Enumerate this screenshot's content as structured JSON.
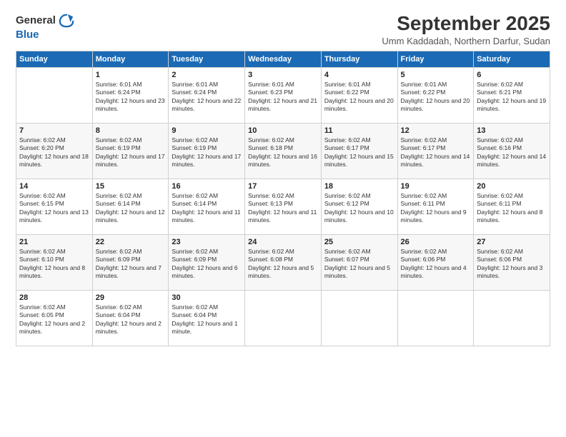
{
  "logo": {
    "general": "General",
    "blue": "Blue"
  },
  "header": {
    "month_year": "September 2025",
    "location": "Umm Kaddadah, Northern Darfur, Sudan"
  },
  "days_of_week": [
    "Sunday",
    "Monday",
    "Tuesday",
    "Wednesday",
    "Thursday",
    "Friday",
    "Saturday"
  ],
  "weeks": [
    [
      {
        "day": "",
        "sunrise": "",
        "sunset": "",
        "daylight": ""
      },
      {
        "day": "1",
        "sunrise": "Sunrise: 6:01 AM",
        "sunset": "Sunset: 6:24 PM",
        "daylight": "Daylight: 12 hours and 23 minutes."
      },
      {
        "day": "2",
        "sunrise": "Sunrise: 6:01 AM",
        "sunset": "Sunset: 6:24 PM",
        "daylight": "Daylight: 12 hours and 22 minutes."
      },
      {
        "day": "3",
        "sunrise": "Sunrise: 6:01 AM",
        "sunset": "Sunset: 6:23 PM",
        "daylight": "Daylight: 12 hours and 21 minutes."
      },
      {
        "day": "4",
        "sunrise": "Sunrise: 6:01 AM",
        "sunset": "Sunset: 6:22 PM",
        "daylight": "Daylight: 12 hours and 20 minutes."
      },
      {
        "day": "5",
        "sunrise": "Sunrise: 6:01 AM",
        "sunset": "Sunset: 6:22 PM",
        "daylight": "Daylight: 12 hours and 20 minutes."
      },
      {
        "day": "6",
        "sunrise": "Sunrise: 6:02 AM",
        "sunset": "Sunset: 6:21 PM",
        "daylight": "Daylight: 12 hours and 19 minutes."
      }
    ],
    [
      {
        "day": "7",
        "sunrise": "Sunrise: 6:02 AM",
        "sunset": "Sunset: 6:20 PM",
        "daylight": "Daylight: 12 hours and 18 minutes."
      },
      {
        "day": "8",
        "sunrise": "Sunrise: 6:02 AM",
        "sunset": "Sunset: 6:19 PM",
        "daylight": "Daylight: 12 hours and 17 minutes."
      },
      {
        "day": "9",
        "sunrise": "Sunrise: 6:02 AM",
        "sunset": "Sunset: 6:19 PM",
        "daylight": "Daylight: 12 hours and 17 minutes."
      },
      {
        "day": "10",
        "sunrise": "Sunrise: 6:02 AM",
        "sunset": "Sunset: 6:18 PM",
        "daylight": "Daylight: 12 hours and 16 minutes."
      },
      {
        "day": "11",
        "sunrise": "Sunrise: 6:02 AM",
        "sunset": "Sunset: 6:17 PM",
        "daylight": "Daylight: 12 hours and 15 minutes."
      },
      {
        "day": "12",
        "sunrise": "Sunrise: 6:02 AM",
        "sunset": "Sunset: 6:17 PM",
        "daylight": "Daylight: 12 hours and 14 minutes."
      },
      {
        "day": "13",
        "sunrise": "Sunrise: 6:02 AM",
        "sunset": "Sunset: 6:16 PM",
        "daylight": "Daylight: 12 hours and 14 minutes."
      }
    ],
    [
      {
        "day": "14",
        "sunrise": "Sunrise: 6:02 AM",
        "sunset": "Sunset: 6:15 PM",
        "daylight": "Daylight: 12 hours and 13 minutes."
      },
      {
        "day": "15",
        "sunrise": "Sunrise: 6:02 AM",
        "sunset": "Sunset: 6:14 PM",
        "daylight": "Daylight: 12 hours and 12 minutes."
      },
      {
        "day": "16",
        "sunrise": "Sunrise: 6:02 AM",
        "sunset": "Sunset: 6:14 PM",
        "daylight": "Daylight: 12 hours and 11 minutes."
      },
      {
        "day": "17",
        "sunrise": "Sunrise: 6:02 AM",
        "sunset": "Sunset: 6:13 PM",
        "daylight": "Daylight: 12 hours and 11 minutes."
      },
      {
        "day": "18",
        "sunrise": "Sunrise: 6:02 AM",
        "sunset": "Sunset: 6:12 PM",
        "daylight": "Daylight: 12 hours and 10 minutes."
      },
      {
        "day": "19",
        "sunrise": "Sunrise: 6:02 AM",
        "sunset": "Sunset: 6:11 PM",
        "daylight": "Daylight: 12 hours and 9 minutes."
      },
      {
        "day": "20",
        "sunrise": "Sunrise: 6:02 AM",
        "sunset": "Sunset: 6:11 PM",
        "daylight": "Daylight: 12 hours and 8 minutes."
      }
    ],
    [
      {
        "day": "21",
        "sunrise": "Sunrise: 6:02 AM",
        "sunset": "Sunset: 6:10 PM",
        "daylight": "Daylight: 12 hours and 8 minutes."
      },
      {
        "day": "22",
        "sunrise": "Sunrise: 6:02 AM",
        "sunset": "Sunset: 6:09 PM",
        "daylight": "Daylight: 12 hours and 7 minutes."
      },
      {
        "day": "23",
        "sunrise": "Sunrise: 6:02 AM",
        "sunset": "Sunset: 6:09 PM",
        "daylight": "Daylight: 12 hours and 6 minutes."
      },
      {
        "day": "24",
        "sunrise": "Sunrise: 6:02 AM",
        "sunset": "Sunset: 6:08 PM",
        "daylight": "Daylight: 12 hours and 5 minutes."
      },
      {
        "day": "25",
        "sunrise": "Sunrise: 6:02 AM",
        "sunset": "Sunset: 6:07 PM",
        "daylight": "Daylight: 12 hours and 5 minutes."
      },
      {
        "day": "26",
        "sunrise": "Sunrise: 6:02 AM",
        "sunset": "Sunset: 6:06 PM",
        "daylight": "Daylight: 12 hours and 4 minutes."
      },
      {
        "day": "27",
        "sunrise": "Sunrise: 6:02 AM",
        "sunset": "Sunset: 6:06 PM",
        "daylight": "Daylight: 12 hours and 3 minutes."
      }
    ],
    [
      {
        "day": "28",
        "sunrise": "Sunrise: 6:02 AM",
        "sunset": "Sunset: 6:05 PM",
        "daylight": "Daylight: 12 hours and 2 minutes."
      },
      {
        "day": "29",
        "sunrise": "Sunrise: 6:02 AM",
        "sunset": "Sunset: 6:04 PM",
        "daylight": "Daylight: 12 hours and 2 minutes."
      },
      {
        "day": "30",
        "sunrise": "Sunrise: 6:02 AM",
        "sunset": "Sunset: 6:04 PM",
        "daylight": "Daylight: 12 hours and 1 minute."
      },
      {
        "day": "",
        "sunrise": "",
        "sunset": "",
        "daylight": ""
      },
      {
        "day": "",
        "sunrise": "",
        "sunset": "",
        "daylight": ""
      },
      {
        "day": "",
        "sunrise": "",
        "sunset": "",
        "daylight": ""
      },
      {
        "day": "",
        "sunrise": "",
        "sunset": "",
        "daylight": ""
      }
    ]
  ]
}
